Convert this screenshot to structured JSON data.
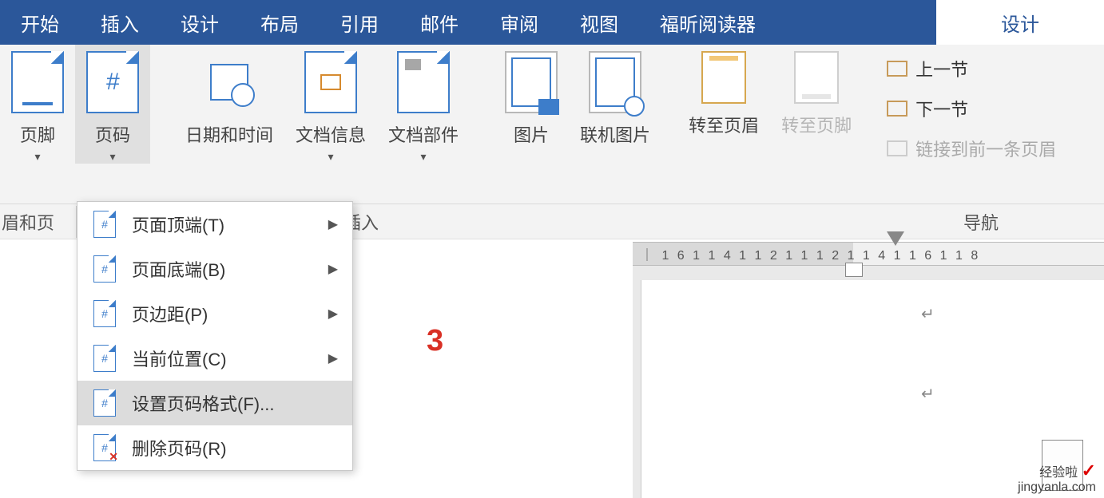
{
  "tabs": [
    "开始",
    "插入",
    "设计",
    "布局",
    "引用",
    "邮件",
    "审阅",
    "视图",
    "福昕阅读器",
    "设计"
  ],
  "active_tab_index": 9,
  "ribbon": {
    "footer": {
      "label": "页脚"
    },
    "pagenum": {
      "label": "页码"
    },
    "datetime": {
      "label": "日期和时间"
    },
    "docinfo": {
      "label": "文档信息"
    },
    "parts": {
      "label": "文档部件"
    },
    "picture": {
      "label": "图片"
    },
    "online_pic": {
      "label": "联机图片"
    },
    "goto_header": {
      "label": "转至页眉"
    },
    "goto_footer": {
      "label": "转至页脚"
    },
    "nav": {
      "prev": "上一节",
      "next": "下一节",
      "link": "链接到前一条页眉"
    }
  },
  "group_labels": {
    "left_truncated": "眉和页",
    "insert": "插入",
    "nav": "导航"
  },
  "menu": {
    "top": "页面顶端(T)",
    "bottom": "页面底端(B)",
    "margin": "页边距(P)",
    "curpos": "当前位置(C)",
    "format": "设置页码格式(F)...",
    "remove": "删除页码(R)",
    "underline": {
      "top": "T",
      "bottom": "B",
      "margin": "P",
      "curpos": "C",
      "format": "F",
      "remove": "R"
    }
  },
  "annotation_number": "3",
  "ruler_text": "｜ 1 6 1    1 4 1    1 2 1    1        1 2 1    1 4 1    1 6 1    1 8",
  "watermark": {
    "line1": "经验啦",
    "line2": "jingyanla.com",
    "check": "✓"
  }
}
